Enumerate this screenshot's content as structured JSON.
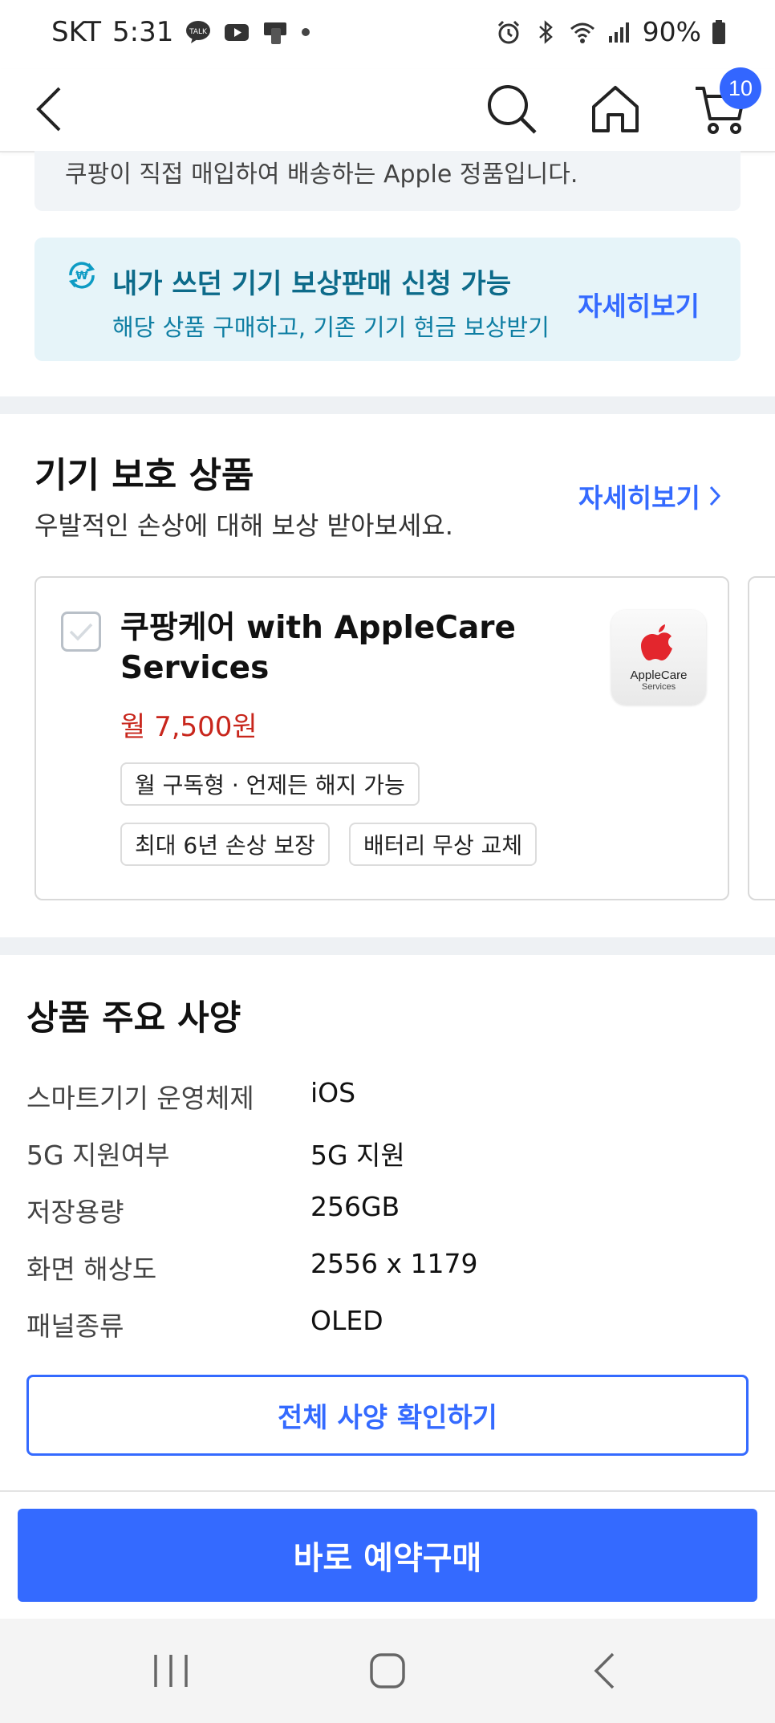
{
  "status_bar": {
    "carrier": "SKT",
    "time": "5:31",
    "battery": "90%",
    "notification_icons": [
      "kakaotalk-icon",
      "youtube-icon",
      "app-icon",
      "dot-icon"
    ],
    "system_icons": [
      "alarm-icon",
      "bluetooth-icon",
      "wifi-icon",
      "signal-icon",
      "battery-icon"
    ]
  },
  "top_nav": {
    "cart_count": "10"
  },
  "notice": {
    "text": "쿠팡이 직접 매입하여 배송하는 Apple 정품입니다."
  },
  "trade_in": {
    "title": "내가 쓰던 기기 보상판매 신청 가능",
    "subtitle": "해당 상품 구매하고, 기존 기기 현금 보상받기",
    "link": "자세히보기"
  },
  "protection": {
    "title": "기기 보호 상품",
    "subtitle": "우발적인 손상에 대해 보상 받아보세요.",
    "link": "자세히보기",
    "card": {
      "title": "쿠팡케어 with AppleCare Services",
      "price": "월 7,500원",
      "tags": [
        "월 구독형 · 언제든 해지 가능",
        "최대 6년 손상 보장",
        "배터리 무상 교체"
      ],
      "logo_name": "AppleCare",
      "logo_sub": "Services",
      "checked": false
    }
  },
  "specs": {
    "title": "상품 주요 사양",
    "rows": [
      {
        "label": "스마트기기 운영체제",
        "value": "iOS"
      },
      {
        "label": "5G 지원여부",
        "value": "5G 지원"
      },
      {
        "label": "저장용량",
        "value": "256GB"
      },
      {
        "label": "화면 해상도",
        "value": "2556 x 1179"
      },
      {
        "label": "패널종류",
        "value": "OLED"
      }
    ],
    "button": "전체 사양 확인하기"
  },
  "buy_button": "바로 예약구매",
  "colors": {
    "accent": "#346aff",
    "price": "#c8261c",
    "tradein_bg": "#e6f4f9",
    "tradein_title": "#0d6b8a"
  }
}
